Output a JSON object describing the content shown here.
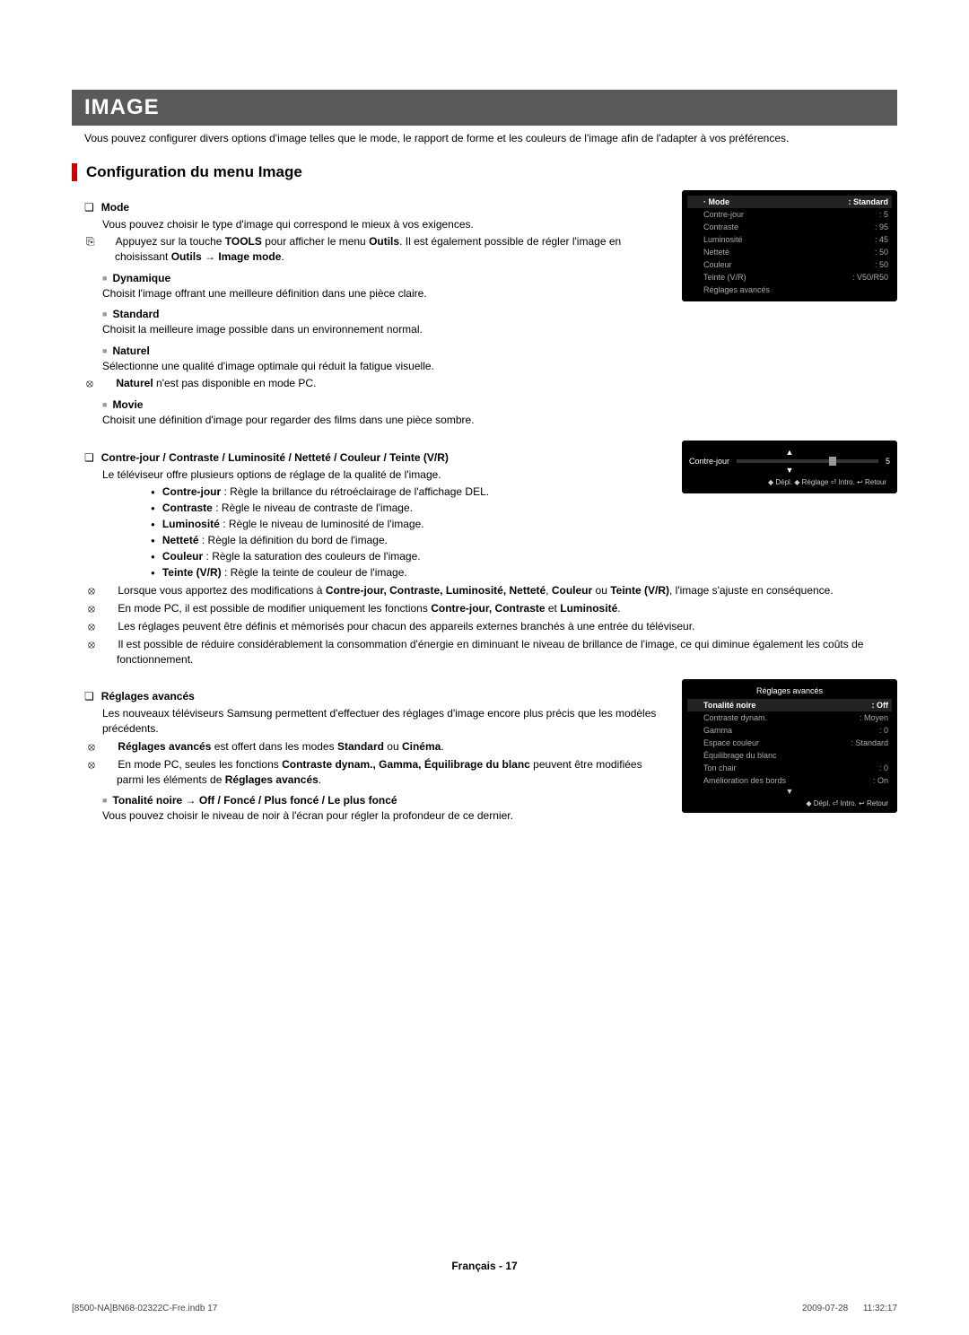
{
  "banner": "IMAGE",
  "intro": "Vous pouvez configurer divers options d'image telles que le mode, le rapport de forme et les couleurs de l'image afin de l'adapter à vos préférences.",
  "section_title": "Configuration du menu Image",
  "mode": {
    "heading": "Mode",
    "desc": "Vous pouvez choisir le type d'image qui correspond le mieux à vos exigences.",
    "tools_a": "Appuyez sur la touche ",
    "tools_b": "TOOLS",
    "tools_c": " pour afficher le menu ",
    "tools_d": "Outils",
    "tools_e": ". Il est également possible de régler l'image en choisissant ",
    "tools_f": "Outils → Image mode",
    "tools_g": ".",
    "items": [
      {
        "name": "Dynamique",
        "desc": "Choisit l'image offrant une meilleure définition dans une pièce claire."
      },
      {
        "name": "Standard",
        "desc": "Choisit la meilleure image possible dans un environnement normal."
      },
      {
        "name": "Naturel",
        "desc": "Sélectionne une qualité d'image optimale qui réduit la fatigue visuelle."
      },
      {
        "name": "Movie",
        "desc": "Choisit une définition d'image pour regarder des films dans une pièce sombre."
      }
    ],
    "naturel_note_a": "Naturel",
    "naturel_note_b": " n'est pas disponible en mode PC."
  },
  "params": {
    "heading": "Contre-jour / Contraste / Luminosité / Netteté / Couleur / Teinte (V/R)",
    "intro": "Le téléviseur offre plusieurs options de réglage de la qualité de l'image.",
    "bullets": [
      {
        "b": "Contre-jour",
        "t": " : Règle la brillance du rétroéclairage de l'affichage DEL."
      },
      {
        "b": "Contraste",
        "t": " : Règle le niveau de contraste de l'image."
      },
      {
        "b": "Luminosité",
        "t": " : Règle le niveau de luminosité de l'image."
      },
      {
        "b": "Netteté",
        "t": " : Règle la définition du bord de l'image."
      },
      {
        "b": "Couleur",
        "t": " : Règle la saturation des couleurs de l'image."
      },
      {
        "b": "Teinte (V/R)",
        "t": " : Règle la teinte de couleur de l'image."
      }
    ],
    "note1_a": "Lorsque vous apportez des modifications à ",
    "note1_b": "Contre-jour, Contraste, Luminosité, Netteté",
    "note1_c": ", ",
    "note1_d": "Couleur",
    "note1_e": " ou ",
    "note1_f": "Teinte (V/R)",
    "note1_g": ", l'image s'ajuste en conséquence.",
    "note2_a": "En mode PC, il est possible de modifier uniquement les fonctions ",
    "note2_b": "Contre-jour, Contraste",
    "note2_c": " et ",
    "note2_d": "Luminosité",
    "note2_e": ".",
    "note3": "Les réglages peuvent être définis et mémorisés pour chacun des appareils externes branchés à une entrée du téléviseur.",
    "note4": "Il est possible de réduire considérablement la consommation d'énergie en diminuant le niveau de brillance de l'image, ce qui diminue également les coûts de fonctionnement."
  },
  "advanced": {
    "heading": "Réglages avancés",
    "desc": "Les nouveaux téléviseurs Samsung permettent d'effectuer des réglages d'image encore plus précis que les modèles précédents.",
    "note1_a": "Réglages avancés",
    "note1_b": " est offert dans les modes ",
    "note1_c": "Standard",
    "note1_d": " ou ",
    "note1_e": "Cinéma",
    "note1_f": ".",
    "note2_a": "En mode PC, seules les fonctions ",
    "note2_b": "Contraste dynam., Gamma, Équilibrage du blanc",
    "note2_c": " peuvent être modifiées parmi les éléments de ",
    "note2_d": "Réglages avancés",
    "note2_e": ".",
    "tonal_head": "Tonalité noire → Off / Foncé / Plus foncé / Le plus foncé",
    "tonal_desc": "Vous pouvez choisir le niveau de noir à l'écran pour régler la profondeur de ce dernier."
  },
  "osd1": {
    "rows": [
      {
        "k": "· Mode",
        "v": ": Standard"
      },
      {
        "k": "Contre-jour",
        "v": ": 5"
      },
      {
        "k": "Contraste",
        "v": ": 95"
      },
      {
        "k": "Luminosité",
        "v": ": 45"
      },
      {
        "k": "Netteté",
        "v": ": 50"
      },
      {
        "k": "Couleur",
        "v": ": 50"
      },
      {
        "k": "Teinte (V/R)",
        "v": ": V50/R50"
      },
      {
        "k": "Réglages avancés",
        "v": ""
      }
    ]
  },
  "osd2": {
    "title": "Contre-jour",
    "value": "5",
    "footer": "◆ Dépl.   ◆ Réglage   ⏎ Intro.   ↩ Retour",
    "arrow_up": "▲",
    "arrow_dn": "▼"
  },
  "osd3": {
    "title": "Réglages avancés",
    "rows": [
      {
        "k": "Tonalité noire",
        "v": ": Off"
      },
      {
        "k": "Contraste dynam.",
        "v": ": Moyen"
      },
      {
        "k": "Gamma",
        "v": ": 0"
      },
      {
        "k": "Espace couleur",
        "v": ": Standard"
      },
      {
        "k": "Équilibrage du blanc",
        "v": ""
      },
      {
        "k": "Ton chair",
        "v": ": 0"
      },
      {
        "k": "Amélioration des bords",
        "v": ": On"
      }
    ],
    "footer": "◆ Dépl.      ⏎ Intro.   ↩ Retour",
    "arrow": "▼"
  },
  "page_footer": "Français - 17",
  "print_left": "[8500-NA]BN68-02322C-Fre.indb   17",
  "print_right": "2009-07-28      11:32:17"
}
